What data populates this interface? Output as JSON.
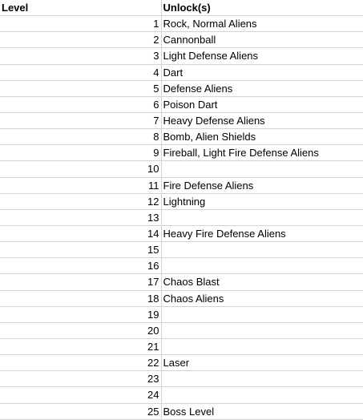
{
  "headers": {
    "level": "Level",
    "unlocks": "Unlock(s)"
  },
  "rows": [
    {
      "level": "1",
      "unlock": "Rock, Normal Aliens"
    },
    {
      "level": "2",
      "unlock": "Cannonball"
    },
    {
      "level": "3",
      "unlock": "Light Defense Aliens"
    },
    {
      "level": "4",
      "unlock": "Dart"
    },
    {
      "level": "5",
      "unlock": "Defense Aliens"
    },
    {
      "level": "6",
      "unlock": "Poison Dart"
    },
    {
      "level": "7",
      "unlock": "Heavy Defense Aliens"
    },
    {
      "level": "8",
      "unlock": "Bomb, Alien Shields"
    },
    {
      "level": "9",
      "unlock": "Fireball, Light Fire Defense Aliens"
    },
    {
      "level": "10",
      "unlock": ""
    },
    {
      "level": "11",
      "unlock": "Fire Defense Aliens"
    },
    {
      "level": "12",
      "unlock": "Lightning"
    },
    {
      "level": "13",
      "unlock": ""
    },
    {
      "level": "14",
      "unlock": "Heavy Fire Defense Aliens"
    },
    {
      "level": "15",
      "unlock": ""
    },
    {
      "level": "16",
      "unlock": ""
    },
    {
      "level": "17",
      "unlock": "Chaos Blast"
    },
    {
      "level": "18",
      "unlock": "Chaos Aliens"
    },
    {
      "level": "19",
      "unlock": ""
    },
    {
      "level": "20",
      "unlock": ""
    },
    {
      "level": "21",
      "unlock": ""
    },
    {
      "level": "22",
      "unlock": "Laser"
    },
    {
      "level": "23",
      "unlock": ""
    },
    {
      "level": "24",
      "unlock": ""
    },
    {
      "level": "25",
      "unlock": "Boss Level"
    }
  ]
}
